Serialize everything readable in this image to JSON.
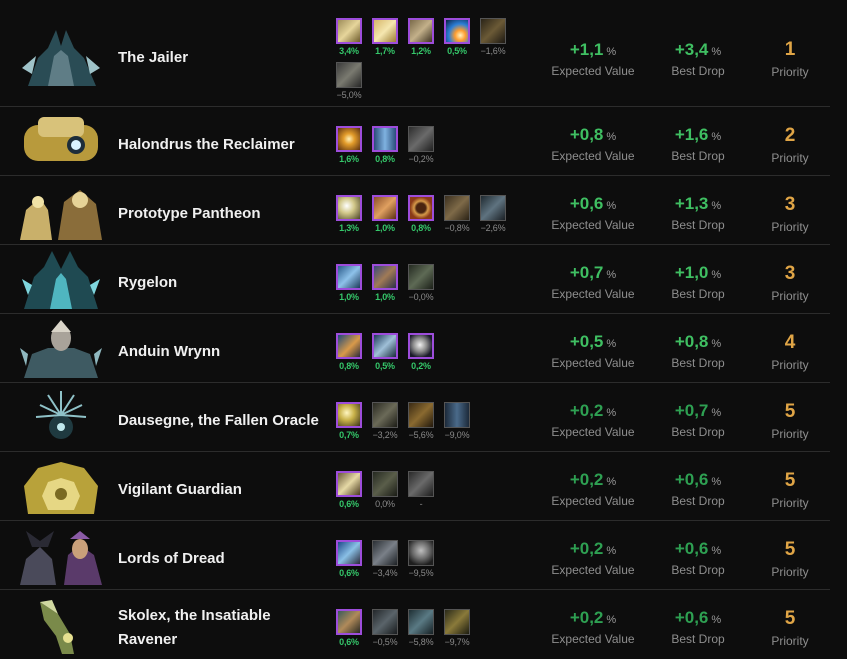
{
  "colors": {
    "background": "#0d0d0d",
    "positive": "#35c76a",
    "priority": "#e0a546",
    "epic_border": "#9d4ddb"
  },
  "rows": [
    {
      "name_lines": [
        "The Jailer",
        ""
      ],
      "portrait": "jailer-portrait",
      "items": [
        {
          "icon": "tome-icon",
          "pct": "3,4%",
          "pos": true,
          "epic": true
        },
        {
          "icon": "scroll-icon",
          "pct": "1,7%",
          "pos": true,
          "epic": true
        },
        {
          "icon": "gauntlet-icon",
          "pct": "1,2%",
          "pos": true,
          "epic": true
        },
        {
          "icon": "comet-icon",
          "pct": "0,5%",
          "pos": true,
          "epic": true
        },
        {
          "icon": "rune-icon",
          "pct": "−1,6%",
          "pos": false,
          "epic": false
        },
        {
          "icon": "belt-icon",
          "pct": "−5,0%",
          "pos": false,
          "epic": false
        }
      ],
      "expected": "+1,1",
      "best": "+3,4",
      "priority": "1",
      "ev_dim": false
    },
    {
      "name_lines": [
        "Halondrus the Reclaimer",
        ""
      ],
      "portrait": "halondrus-portrait",
      "items": [
        {
          "icon": "burst-icon",
          "pct": "1,6%",
          "pos": true,
          "epic": true
        },
        {
          "icon": "pillar-icon",
          "pct": "0,8%",
          "pos": true,
          "epic": true
        },
        {
          "icon": "glove-icon",
          "pct": "−0,2%",
          "pos": false,
          "epic": false
        }
      ],
      "expected": "+0,8",
      "best": "+1,6",
      "priority": "2",
      "ev_dim": false
    },
    {
      "name_lines": [
        "Prototype Pantheon",
        ""
      ],
      "portrait": "pantheon-portrait",
      "items": [
        {
          "icon": "spark-icon",
          "pct": "1,3%",
          "pos": true,
          "epic": true
        },
        {
          "icon": "cloak-icon",
          "pct": "1,0%",
          "pos": true,
          "epic": true
        },
        {
          "icon": "ring-icon",
          "pct": "0,8%",
          "pos": true,
          "epic": true
        },
        {
          "icon": "boots-icon",
          "pct": "−0,8%",
          "pos": false,
          "epic": false
        },
        {
          "icon": "shoulder-icon",
          "pct": "−2,6%",
          "pos": false,
          "epic": false
        }
      ],
      "expected": "+0,6",
      "best": "+1,3",
      "priority": "3",
      "ev_dim": false
    },
    {
      "name_lines": [
        "Rygelon",
        ""
      ],
      "portrait": "rygelon-portrait",
      "items": [
        {
          "icon": "chest-icon",
          "pct": "1,0%",
          "pos": true,
          "epic": true
        },
        {
          "icon": "robe-icon",
          "pct": "1,0%",
          "pos": true,
          "epic": true
        },
        {
          "icon": "helm-icon",
          "pct": "−0,0%",
          "pos": false,
          "epic": false
        }
      ],
      "expected": "+0,7",
      "best": "+1,0",
      "priority": "3",
      "ev_dim": false
    },
    {
      "name_lines": [
        "Anduin Wrynn",
        ""
      ],
      "portrait": "anduin-portrait",
      "items": [
        {
          "icon": "legs-icon",
          "pct": "0,8%",
          "pos": true,
          "epic": true
        },
        {
          "icon": "bracer-icon",
          "pct": "0,5%",
          "pos": true,
          "epic": true
        },
        {
          "icon": "shield-icon",
          "pct": "0,2%",
          "pos": true,
          "epic": true
        }
      ],
      "expected": "+0,5",
      "best": "+0,8",
      "priority": "4",
      "ev_dim": false
    },
    {
      "name_lines": [
        "Dausegne, the Fallen Oracle",
        ""
      ],
      "portrait": "dausegne-portrait",
      "items": [
        {
          "icon": "wand-icon",
          "pct": "0,7%",
          "pos": true,
          "epic": true
        },
        {
          "icon": "mask-icon",
          "pct": "−3,2%",
          "pos": false,
          "epic": false
        },
        {
          "icon": "cape-icon",
          "pct": "−5,6%",
          "pos": false,
          "epic": false
        },
        {
          "icon": "leggings-icon",
          "pct": "−9,0%",
          "pos": false,
          "epic": false
        }
      ],
      "expected": "+0,2",
      "best": "+0,7",
      "priority": "5",
      "ev_dim": true
    },
    {
      "name_lines": [
        "Vigilant Guardian",
        ""
      ],
      "portrait": "guardian-portrait",
      "items": [
        {
          "icon": "relic-icon",
          "pct": "0,6%",
          "pos": true,
          "epic": true
        },
        {
          "icon": "hood-icon",
          "pct": "0,0%",
          "pos": false,
          "epic": false
        },
        {
          "icon": "vest-icon",
          "pct": "-",
          "pos": false,
          "epic": false
        }
      ],
      "expected": "+0,2",
      "best": "+0,6",
      "priority": "5",
      "ev_dim": true
    },
    {
      "name_lines": [
        "Lords of Dread",
        ""
      ],
      "portrait": "lords-portrait",
      "items": [
        {
          "icon": "tunic-icon",
          "pct": "0,6%",
          "pos": true,
          "epic": true
        },
        {
          "icon": "pauldron-icon",
          "pct": "−3,4%",
          "pos": false,
          "epic": false
        },
        {
          "icon": "helmet-icon",
          "pct": "−9,5%",
          "pos": false,
          "epic": false
        }
      ],
      "expected": "+0,2",
      "best": "+0,6",
      "priority": "5",
      "ev_dim": true
    },
    {
      "name_lines": [
        "Skolex, the Insatiable",
        "Ravener"
      ],
      "portrait": "skolex-portrait",
      "items": [
        {
          "icon": "sash-icon",
          "pct": "0,6%",
          "pos": true,
          "epic": true
        },
        {
          "icon": "gloves-icon",
          "pct": "−0,5%",
          "pos": false,
          "epic": false
        },
        {
          "icon": "spaulder-icon",
          "pct": "−5,8%",
          "pos": false,
          "epic": false
        },
        {
          "icon": "staff-icon",
          "pct": "−9,7%",
          "pos": false,
          "epic": false
        }
      ],
      "expected": "+0,2",
      "best": "+0,6",
      "priority": "5",
      "ev_dim": true
    }
  ],
  "labels": {
    "expected": "Expected Value",
    "best": "Best Drop",
    "priority": "Priority",
    "unit": "%"
  }
}
